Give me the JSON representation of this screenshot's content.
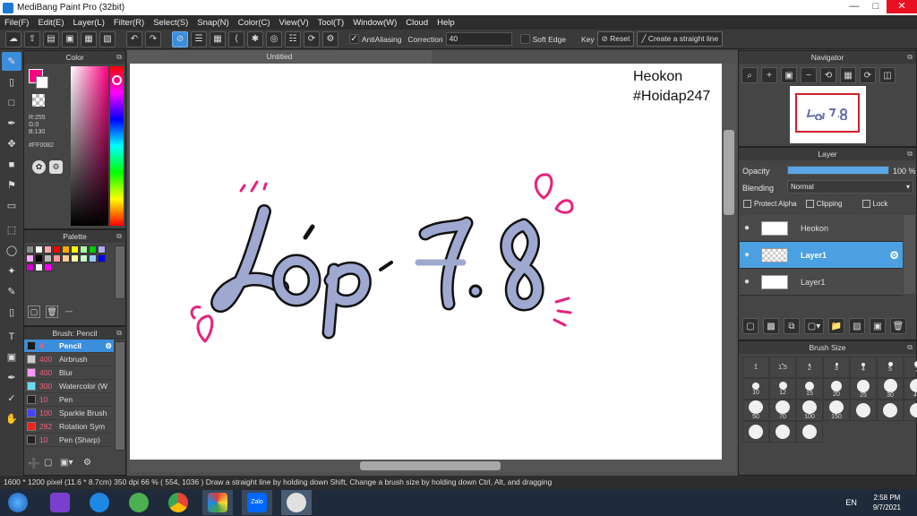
{
  "window": {
    "title": "MediBang Paint Pro (32bit)"
  },
  "menu": [
    "File(F)",
    "Edit(E)",
    "Layer(L)",
    "Filter(R)",
    "Select(S)",
    "Snap(N)",
    "Color(C)",
    "View(V)",
    "Tool(T)",
    "Window(W)",
    "Cloud",
    "Help"
  ],
  "toolbar": {
    "antialiasing_label": "AntiAliasing",
    "correction_label": "Correction",
    "correction_value": "40",
    "soft_edge_label": "Soft Edge",
    "key_label": "Key",
    "reset_label": "Reset",
    "straight_line_label": "Create a straight line"
  },
  "color_panel": {
    "title": "Color",
    "r": "R:255",
    "g": "G:0",
    "b": "B:130",
    "hex": "#FF0082",
    "primary_color": "#ff0082"
  },
  "palette_panel": {
    "title": "Palette",
    "swatches": [
      "#888888",
      "#ffffff",
      "#ffaaaa",
      "#ff0000",
      "#ffaa00",
      "#ffff00",
      "#aaffaa",
      "#00cc00",
      "#aaaaff",
      "#ffaaff",
      "#000000",
      "#bbbbbb",
      "#ff9999",
      "#ffcc99",
      "#ffffaa",
      "#ccffcc",
      "#99ccff",
      "#0000ff",
      "#cc00cc",
      "#ffffff",
      "#ff00ff"
    ],
    "dash": "---"
  },
  "brush_panel": {
    "title": "Brush: Pencil",
    "items": [
      {
        "size": "4",
        "name": "Pencil",
        "color": "#1a1a1a"
      },
      {
        "size": "400",
        "name": "Airbrush",
        "color": "#cccccc"
      },
      {
        "size": "400",
        "name": "Blur",
        "color": "#ff99ff"
      },
      {
        "size": "300",
        "name": "Watercolor (W",
        "color": "#66ddee"
      },
      {
        "size": "10",
        "name": "Pen",
        "color": "#222222"
      },
      {
        "size": "100",
        "name": "Sparkle Brush",
        "color": "#4444ff"
      },
      {
        "size": "282",
        "name": "Rotation Sym",
        "color": "#ee2222"
      },
      {
        "size": "10",
        "name": "Pen (Sharp)",
        "color": "#222222"
      }
    ]
  },
  "document": {
    "tab": "Untitled",
    "watermark_line1": "Heokon",
    "watermark_line2": "#Hoidap247",
    "artwork_text": "Lớp 7.8"
  },
  "navigator": {
    "title": "Navigator"
  },
  "layer_panel": {
    "title": "Layer",
    "opacity_label": "Opacity",
    "opacity_value": "100 %",
    "opacity": 1.0,
    "blending_label": "Blending",
    "blending_value": "Normal",
    "protect_alpha": "Protect Alpha",
    "clipping": "Clipping",
    "lock": "Lock",
    "layers": [
      {
        "name": "Heokon",
        "selected": false
      },
      {
        "name": "Layer1",
        "selected": true
      },
      {
        "name": "Layer1",
        "selected": false
      }
    ]
  },
  "brush_size_panel": {
    "title": "Brush Size",
    "sizes": [
      "1",
      "1.5",
      "2",
      "3",
      "4",
      "5",
      "7",
      "10",
      "12",
      "15",
      "20",
      "25",
      "30",
      "40",
      "50",
      "70",
      "100",
      "150",
      "",
      "",
      "",
      "",
      "",
      ""
    ]
  },
  "status": {
    "text": "1600 * 1200 pixel   (11.6 * 8.7cm)   350 dpi   66 %   ( 554, 1036 )   Draw a straight line by holding down Shift, Change a brush size by holding down Ctrl, Alt, and dragging"
  },
  "taskbar": {
    "lang": "EN",
    "time": "2:58 PM",
    "date": "9/7/2021",
    "zalo_label": "Zalo"
  }
}
